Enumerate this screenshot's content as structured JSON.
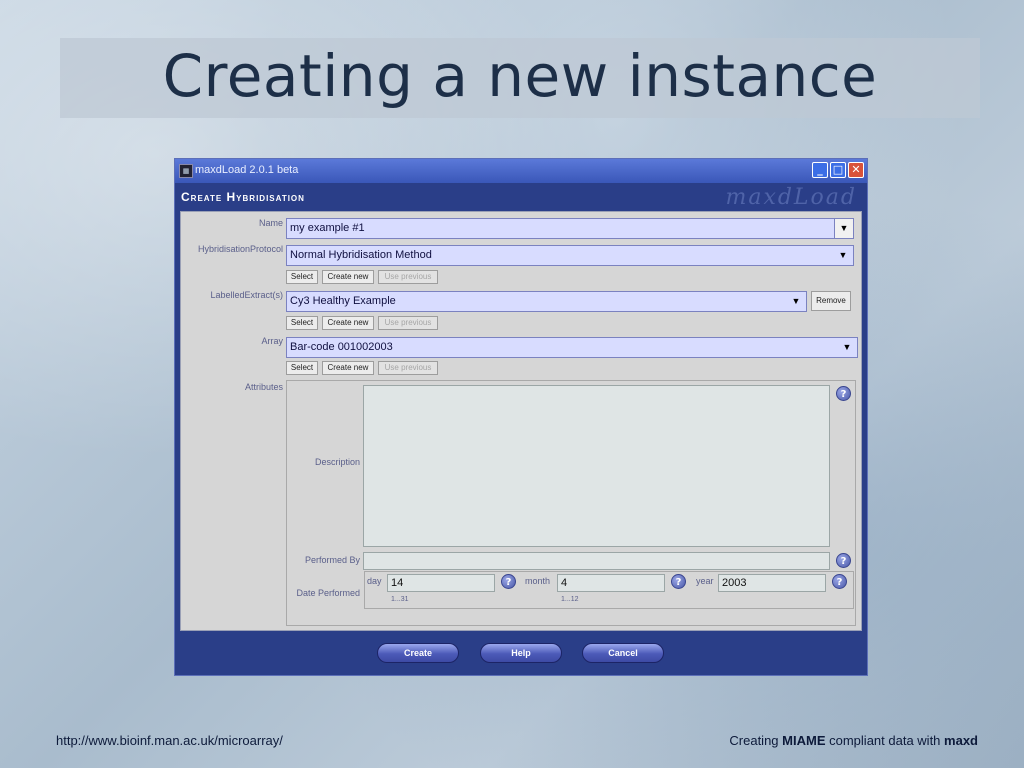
{
  "slide": {
    "title": "Creating a new instance",
    "footer_url": "http://www.bioinf.man.ac.uk/microarray/",
    "footer_prefix": "Creating",
    "footer_bold1": "MIAME",
    "footer_middle": "compliant data with",
    "footer_bold2": "maxd"
  },
  "window": {
    "title": "maxdLoad 2.0.1 beta",
    "form_title": "Create Hybridisation",
    "watermark": "maxdLoad",
    "minimize": "_",
    "maximize": "□",
    "close": "✕"
  },
  "form": {
    "name_label": "Name",
    "name_value": "my example #1",
    "protocol_label": "HybridisationProtocol",
    "protocol_value": "Normal Hybridisation Method",
    "extract_label": "LabelledExtract(s)",
    "extract_value": "Cy3 Healthy Example",
    "array_label": "Array",
    "array_value": "Bar-code 001002003",
    "attributes_label": "Attributes",
    "select_label": "Select",
    "create_new_label": "Create new",
    "use_previous_label": "Use previous",
    "remove_label": "Remove",
    "description_label": "Description",
    "description_value": "",
    "performed_by_label": "Performed By",
    "performed_by_value": "",
    "date_performed_label": "Date Performed",
    "day_label": "day",
    "day_value": "14",
    "day_hint": "1...31",
    "month_label": "month",
    "month_value": "4",
    "month_hint": "1...12",
    "year_label": "year",
    "year_value": "2003",
    "help_glyph": "?"
  },
  "buttons": {
    "create": "Create",
    "help": "Help",
    "cancel": "Cancel"
  }
}
